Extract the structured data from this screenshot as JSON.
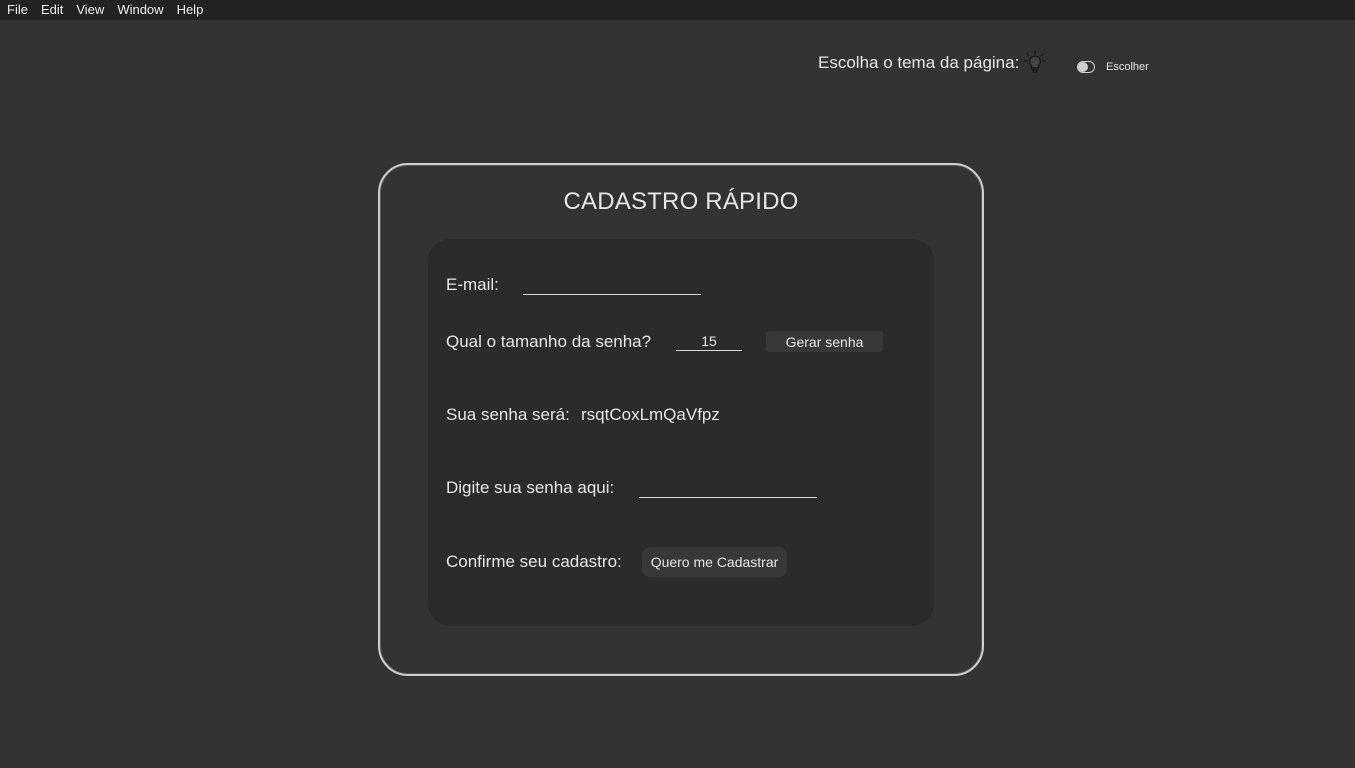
{
  "menu": {
    "items": [
      "File",
      "Edit",
      "View",
      "Window",
      "Help"
    ]
  },
  "theme": {
    "label": "Escolha o tema da página:",
    "bulb_icon": "lightbulb-icon",
    "toggle_label": "Escolher"
  },
  "card": {
    "title": "CADASTRO RÁPIDO"
  },
  "form": {
    "email_label": "E-mail:",
    "email_value": "",
    "size_label": "Qual o tamanho da senha?",
    "size_value": "15",
    "generate_button": "Gerar senha",
    "password_label": "Sua senha será:",
    "password_value": "rsqtCoxLmQaVfpz",
    "type_password_label": "Digite sua senha aqui:",
    "type_password_value": "",
    "confirm_label": "Confirme seu cadastro:",
    "register_button": "Quero me Cadastrar"
  },
  "colors": {
    "background": "#333333",
    "panel": "#2b2b2b",
    "menubar": "#222222",
    "text": "#e6e6e6"
  }
}
